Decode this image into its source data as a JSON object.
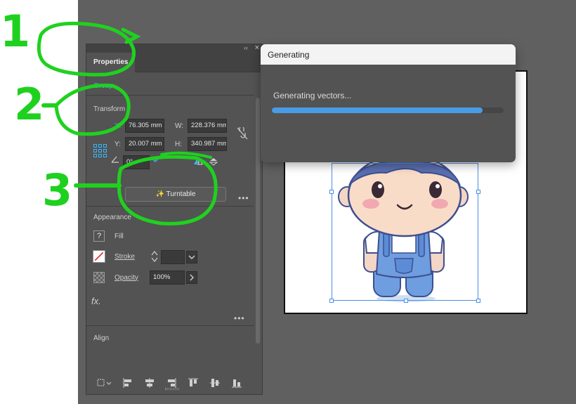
{
  "panel": {
    "tab": "Properties",
    "collapse_glyph": "‹‹",
    "close_glyph": "×",
    "group_label": "Group",
    "transform_label": "Transform",
    "x_label": "X:",
    "x_value": "76.305 mm",
    "y_label": "Y:",
    "y_value": "20.007 mm",
    "w_label": "W:",
    "w_value": "228.376 mm",
    "h_label": "H:",
    "h_value": "340.987 mm",
    "angle_value": "0°",
    "turntable_label": "Turntable",
    "appearance_label": "Appearance",
    "fill_label": "Fill",
    "stroke_label": "Stroke",
    "opacity_label": "Opacity",
    "opacity_value": "100%",
    "fx_label": "fx.",
    "align_label": "Align",
    "more_glyph": "•••"
  },
  "dialog": {
    "title": "Generating",
    "status": "Generating vectors...",
    "progress": 0.91
  },
  "annotations": {
    "one": "1",
    "two": "2",
    "three": "3"
  },
  "colors": {
    "accent": "#38b6ff",
    "annotation": "#1fd11f",
    "progress": "#4a9be6"
  }
}
